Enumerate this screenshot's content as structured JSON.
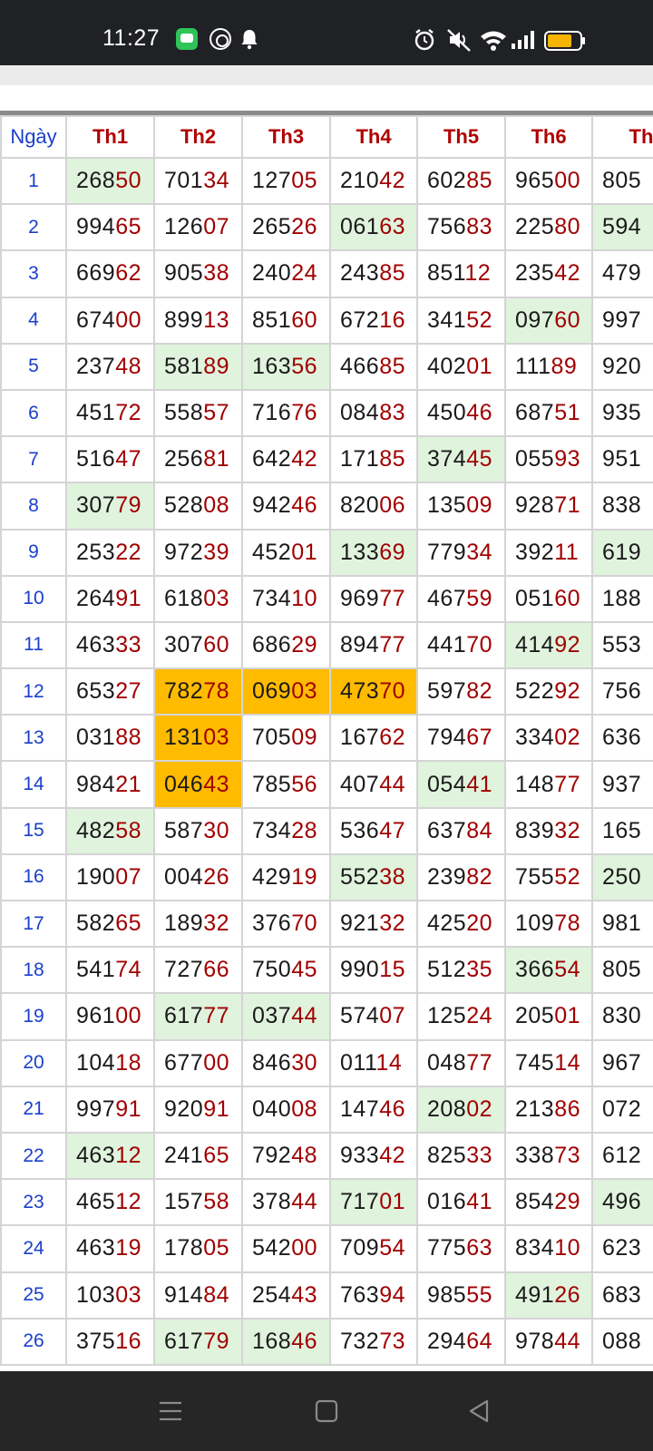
{
  "status_bar": {
    "time": "11:27",
    "icons": [
      "chat-app-icon",
      "shutter-app-icon",
      "bell-icon",
      "alarm-icon",
      "mute-icon",
      "wifi-icon",
      "signal-icon",
      "battery-icon"
    ]
  },
  "table": {
    "headers": [
      "Ngày",
      "Th1",
      "Th2",
      "Th3",
      "Th4",
      "Th5",
      "Th6",
      "Th"
    ],
    "rows": [
      {
        "day": "1",
        "cells": [
          [
            "268",
            "50"
          ],
          [
            "701",
            "34"
          ],
          [
            "127",
            "05"
          ],
          [
            "210",
            "42"
          ],
          [
            "602",
            "85"
          ],
          [
            "965",
            "00"
          ],
          [
            "805",
            ""
          ]
        ],
        "hl": [
          "g",
          "",
          "",
          "",
          "",
          "",
          ""
        ]
      },
      {
        "day": "2",
        "cells": [
          [
            "994",
            "65"
          ],
          [
            "126",
            "07"
          ],
          [
            "265",
            "26"
          ],
          [
            "061",
            "63"
          ],
          [
            "756",
            "83"
          ],
          [
            "225",
            "80"
          ],
          [
            "594",
            ""
          ]
        ],
        "hl": [
          "",
          "",
          "",
          "g",
          "",
          "",
          "g"
        ]
      },
      {
        "day": "3",
        "cells": [
          [
            "669",
            "62"
          ],
          [
            "905",
            "38"
          ],
          [
            "240",
            "24"
          ],
          [
            "243",
            "85"
          ],
          [
            "851",
            "12"
          ],
          [
            "235",
            "42"
          ],
          [
            "479",
            ""
          ]
        ],
        "hl": [
          "",
          "",
          "",
          "",
          "",
          "",
          ""
        ]
      },
      {
        "day": "4",
        "cells": [
          [
            "674",
            "00"
          ],
          [
            "899",
            "13"
          ],
          [
            "851",
            "60"
          ],
          [
            "672",
            "16"
          ],
          [
            "341",
            "52"
          ],
          [
            "097",
            "60"
          ],
          [
            "997",
            ""
          ]
        ],
        "hl": [
          "",
          "",
          "",
          "",
          "",
          "g",
          ""
        ]
      },
      {
        "day": "5",
        "cells": [
          [
            "237",
            "48"
          ],
          [
            "581",
            "89"
          ],
          [
            "163",
            "56"
          ],
          [
            "466",
            "85"
          ],
          [
            "402",
            "01"
          ],
          [
            "111",
            "89"
          ],
          [
            "920",
            ""
          ]
        ],
        "hl": [
          "",
          "g",
          "g",
          "",
          "",
          "",
          ""
        ]
      },
      {
        "day": "6",
        "cells": [
          [
            "451",
            "72"
          ],
          [
            "558",
            "57"
          ],
          [
            "716",
            "76"
          ],
          [
            "084",
            "83"
          ],
          [
            "450",
            "46"
          ],
          [
            "687",
            "51"
          ],
          [
            "935",
            ""
          ]
        ],
        "hl": [
          "",
          "",
          "",
          "",
          "",
          "",
          ""
        ]
      },
      {
        "day": "7",
        "cells": [
          [
            "516",
            "47"
          ],
          [
            "256",
            "81"
          ],
          [
            "642",
            "42"
          ],
          [
            "171",
            "85"
          ],
          [
            "374",
            "45"
          ],
          [
            "055",
            "93"
          ],
          [
            "951",
            ""
          ]
        ],
        "hl": [
          "",
          "",
          "",
          "",
          "g",
          "",
          ""
        ]
      },
      {
        "day": "8",
        "cells": [
          [
            "307",
            "79"
          ],
          [
            "528",
            "08"
          ],
          [
            "942",
            "46"
          ],
          [
            "820",
            "06"
          ],
          [
            "135",
            "09"
          ],
          [
            "928",
            "71"
          ],
          [
            "838",
            ""
          ]
        ],
        "hl": [
          "g",
          "",
          "",
          "",
          "",
          "",
          ""
        ]
      },
      {
        "day": "9",
        "cells": [
          [
            "253",
            "22"
          ],
          [
            "972",
            "39"
          ],
          [
            "452",
            "01"
          ],
          [
            "133",
            "69"
          ],
          [
            "779",
            "34"
          ],
          [
            "392",
            "11"
          ],
          [
            "619",
            ""
          ]
        ],
        "hl": [
          "",
          "",
          "",
          "g",
          "",
          "",
          "g"
        ]
      },
      {
        "day": "10",
        "cells": [
          [
            "264",
            "91"
          ],
          [
            "618",
            "03"
          ],
          [
            "734",
            "10"
          ],
          [
            "969",
            "77"
          ],
          [
            "467",
            "59"
          ],
          [
            "051",
            "60"
          ],
          [
            "188",
            ""
          ]
        ],
        "hl": [
          "",
          "",
          "",
          "",
          "",
          "",
          ""
        ]
      },
      {
        "day": "11",
        "cells": [
          [
            "463",
            "33"
          ],
          [
            "307",
            "60"
          ],
          [
            "686",
            "29"
          ],
          [
            "894",
            "77"
          ],
          [
            "441",
            "70"
          ],
          [
            "414",
            "92"
          ],
          [
            "553",
            ""
          ]
        ],
        "hl": [
          "",
          "",
          "",
          "",
          "",
          "g",
          ""
        ]
      },
      {
        "day": "12",
        "cells": [
          [
            "653",
            "27"
          ],
          [
            "782",
            "78"
          ],
          [
            "069",
            "03"
          ],
          [
            "473",
            "70"
          ],
          [
            "597",
            "82"
          ],
          [
            "522",
            "92"
          ],
          [
            "756",
            ""
          ]
        ],
        "hl": [
          "",
          "o",
          "o",
          "o",
          "",
          "",
          ""
        ]
      },
      {
        "day": "13",
        "cells": [
          [
            "031",
            "88"
          ],
          [
            "131",
            "03"
          ],
          [
            "705",
            "09"
          ],
          [
            "167",
            "62"
          ],
          [
            "794",
            "67"
          ],
          [
            "334",
            "02"
          ],
          [
            "636",
            ""
          ]
        ],
        "hl": [
          "",
          "o",
          "",
          "",
          "",
          "",
          ""
        ]
      },
      {
        "day": "14",
        "cells": [
          [
            "984",
            "21"
          ],
          [
            "046",
            "43"
          ],
          [
            "785",
            "56"
          ],
          [
            "407",
            "44"
          ],
          [
            "054",
            "41"
          ],
          [
            "148",
            "77"
          ],
          [
            "937",
            ""
          ]
        ],
        "hl": [
          "",
          "o",
          "",
          "",
          "g",
          "",
          ""
        ]
      },
      {
        "day": "15",
        "cells": [
          [
            "482",
            "58"
          ],
          [
            "587",
            "30"
          ],
          [
            "734",
            "28"
          ],
          [
            "536",
            "47"
          ],
          [
            "637",
            "84"
          ],
          [
            "839",
            "32"
          ],
          [
            "165",
            ""
          ]
        ],
        "hl": [
          "g",
          "",
          "",
          "",
          "",
          "",
          ""
        ]
      },
      {
        "day": "16",
        "cells": [
          [
            "190",
            "07"
          ],
          [
            "004",
            "26"
          ],
          [
            "429",
            "19"
          ],
          [
            "552",
            "38"
          ],
          [
            "239",
            "82"
          ],
          [
            "755",
            "52"
          ],
          [
            "250",
            ""
          ]
        ],
        "hl": [
          "",
          "",
          "",
          "g",
          "",
          "",
          "g"
        ]
      },
      {
        "day": "17",
        "cells": [
          [
            "582",
            "65"
          ],
          [
            "189",
            "32"
          ],
          [
            "376",
            "70"
          ],
          [
            "921",
            "32"
          ],
          [
            "425",
            "20"
          ],
          [
            "109",
            "78"
          ],
          [
            "981",
            ""
          ]
        ],
        "hl": [
          "",
          "",
          "",
          "",
          "",
          "",
          ""
        ]
      },
      {
        "day": "18",
        "cells": [
          [
            "541",
            "74"
          ],
          [
            "727",
            "66"
          ],
          [
            "750",
            "45"
          ],
          [
            "990",
            "15"
          ],
          [
            "512",
            "35"
          ],
          [
            "366",
            "54"
          ],
          [
            "805",
            ""
          ]
        ],
        "hl": [
          "",
          "",
          "",
          "",
          "",
          "g",
          ""
        ]
      },
      {
        "day": "19",
        "cells": [
          [
            "961",
            "00"
          ],
          [
            "617",
            "77"
          ],
          [
            "037",
            "44"
          ],
          [
            "574",
            "07"
          ],
          [
            "125",
            "24"
          ],
          [
            "205",
            "01"
          ],
          [
            "830",
            ""
          ]
        ],
        "hl": [
          "",
          "g",
          "g",
          "",
          "",
          "",
          ""
        ]
      },
      {
        "day": "20",
        "cells": [
          [
            "104",
            "18"
          ],
          [
            "677",
            "00"
          ],
          [
            "846",
            "30"
          ],
          [
            "011",
            "14"
          ],
          [
            "048",
            "77"
          ],
          [
            "745",
            "14"
          ],
          [
            "967",
            ""
          ]
        ],
        "hl": [
          "",
          "",
          "",
          "",
          "",
          "",
          ""
        ]
      },
      {
        "day": "21",
        "cells": [
          [
            "997",
            "91"
          ],
          [
            "920",
            "91"
          ],
          [
            "040",
            "08"
          ],
          [
            "147",
            "46"
          ],
          [
            "208",
            "02"
          ],
          [
            "213",
            "86"
          ],
          [
            "072",
            ""
          ]
        ],
        "hl": [
          "",
          "",
          "",
          "",
          "g",
          "",
          ""
        ]
      },
      {
        "day": "22",
        "cells": [
          [
            "463",
            "12"
          ],
          [
            "241",
            "65"
          ],
          [
            "792",
            "48"
          ],
          [
            "933",
            "42"
          ],
          [
            "825",
            "33"
          ],
          [
            "338",
            "73"
          ],
          [
            "612",
            ""
          ]
        ],
        "hl": [
          "g",
          "",
          "",
          "",
          "",
          "",
          ""
        ]
      },
      {
        "day": "23",
        "cells": [
          [
            "465",
            "12"
          ],
          [
            "157",
            "58"
          ],
          [
            "378",
            "44"
          ],
          [
            "717",
            "01"
          ],
          [
            "016",
            "41"
          ],
          [
            "854",
            "29"
          ],
          [
            "496",
            ""
          ]
        ],
        "hl": [
          "",
          "",
          "",
          "g",
          "",
          "",
          "g"
        ]
      },
      {
        "day": "24",
        "cells": [
          [
            "463",
            "19"
          ],
          [
            "178",
            "05"
          ],
          [
            "542",
            "00"
          ],
          [
            "709",
            "54"
          ],
          [
            "775",
            "63"
          ],
          [
            "834",
            "10"
          ],
          [
            "623",
            ""
          ]
        ],
        "hl": [
          "",
          "",
          "",
          "",
          "",
          "",
          ""
        ]
      },
      {
        "day": "25",
        "cells": [
          [
            "103",
            "03"
          ],
          [
            "914",
            "84"
          ],
          [
            "254",
            "43"
          ],
          [
            "763",
            "94"
          ],
          [
            "985",
            "55"
          ],
          [
            "491",
            "26"
          ],
          [
            "683",
            ""
          ]
        ],
        "hl": [
          "",
          "",
          "",
          "",
          "",
          "g",
          ""
        ]
      },
      {
        "day": "26",
        "cells": [
          [
            "375",
            "16"
          ],
          [
            "617",
            "79"
          ],
          [
            "168",
            "46"
          ],
          [
            "732",
            "73"
          ],
          [
            "294",
            "64"
          ],
          [
            "978",
            "44"
          ],
          [
            "088",
            ""
          ]
        ],
        "hl": [
          "",
          "g",
          "g",
          "",
          "",
          "",
          ""
        ]
      }
    ]
  },
  "nav_bar": {
    "buttons": [
      "menu-button",
      "home-button",
      "back-button"
    ]
  },
  "colors": {
    "green_highlight": "#e0f3dd",
    "orange_highlight": "#ffbb00",
    "header_red": "#b00000",
    "day_blue": "#1a3fcc"
  }
}
